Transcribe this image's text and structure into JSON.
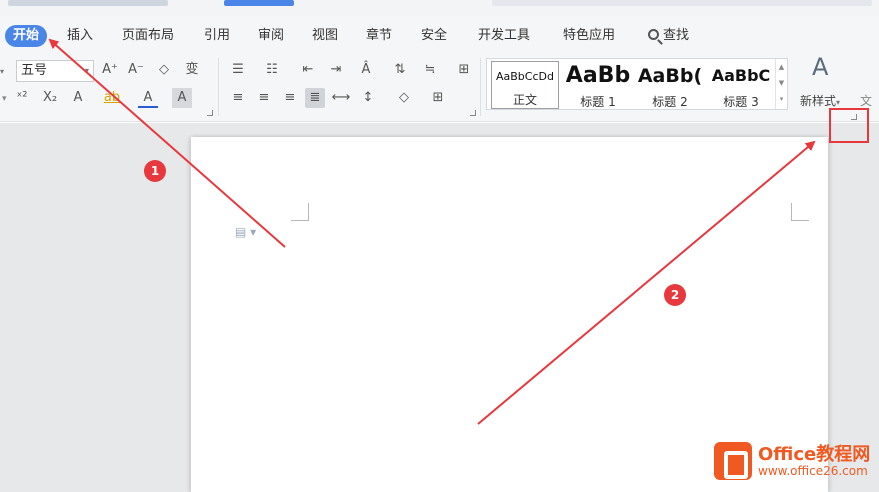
{
  "menu": {
    "tabs": [
      "开始",
      "插入",
      "页面布局",
      "引用",
      "审阅",
      "视图",
      "章节",
      "安全",
      "开发工具",
      "特色应用",
      "查找"
    ]
  },
  "ribbon": {
    "font_size": "五号",
    "font_buttons": [
      "A⁺",
      "A⁻",
      "◇",
      "变"
    ],
    "format_buttons": [
      "ˣ²",
      "X₂",
      "A",
      "ab",
      "A",
      "A"
    ],
    "new_style_label": "新样式",
    "styles": [
      {
        "preview": "AaBbCcDd",
        "name": "正文"
      },
      {
        "preview": "AaBb",
        "name": "标题 1"
      },
      {
        "preview": "AaBb(",
        "name": "标题 2"
      },
      {
        "preview": "AaBbC",
        "name": "标题 3"
      }
    ]
  },
  "annotations": {
    "badge1": "1",
    "badge2": "2",
    "accent_color": "#e8383d"
  },
  "watermark": {
    "title": "Office教程网",
    "url": "www.office26.com",
    "color": "#f05a22"
  },
  "colors": {
    "tab_active": "#4a86e8",
    "ribbon_bg": "#f5f6f7",
    "canvas_bg": "#e7e8ea"
  }
}
